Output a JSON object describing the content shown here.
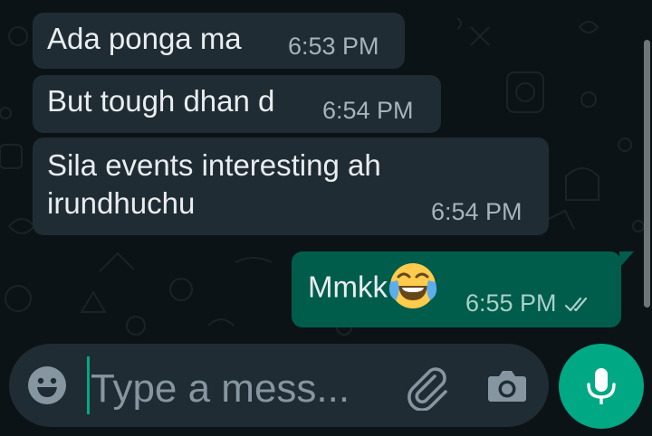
{
  "messages": [
    {
      "direction": "in",
      "text": "Ada ponga ma",
      "time": "6:53 PM"
    },
    {
      "direction": "in",
      "text": "But tough dhan d",
      "time": "6:54 PM"
    },
    {
      "direction": "in",
      "text": "Sila events interesting ah\nirundhuchu",
      "time": "6:54 PM"
    },
    {
      "direction": "out",
      "text": "Mmkk",
      "emoji": "face-with-tears-of-joy",
      "time": "6:55 PM",
      "status": "read-double-tick"
    }
  ],
  "composer": {
    "placeholder": "Type a mess...",
    "emoji_icon": "emoji-face-icon",
    "attach_icon": "paperclip-icon",
    "camera_icon": "camera-icon",
    "mic_icon": "microphone-icon"
  },
  "colors": {
    "background": "#0c1317",
    "incoming_bubble": "#1f2c33",
    "outgoing_bubble": "#005c4b",
    "accent": "#00a884",
    "text": "#e9edef",
    "meta_text": "#a7b3b9"
  }
}
